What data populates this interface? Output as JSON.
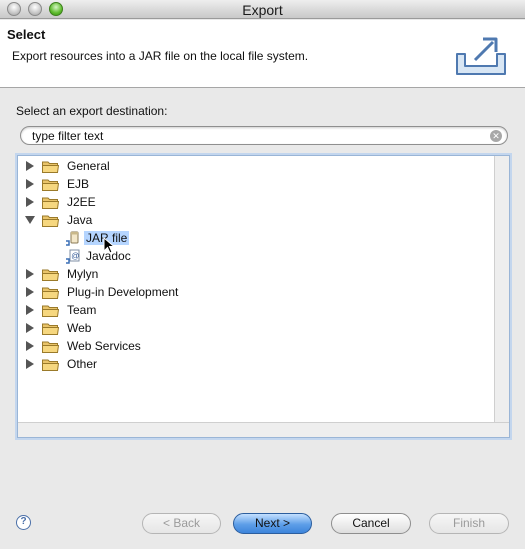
{
  "window": {
    "title": "Export"
  },
  "banner": {
    "title": "Select",
    "description": "Export resources into a JAR file on the local file system."
  },
  "destination": {
    "label": "Select an export destination:",
    "filter_value": "type filter text"
  },
  "tree": {
    "folders": [
      {
        "label": "General",
        "expanded": false
      },
      {
        "label": "EJB",
        "expanded": false
      },
      {
        "label": "J2EE",
        "expanded": false
      },
      {
        "label": "Java",
        "expanded": true
      },
      {
        "label": "Mylyn",
        "expanded": false
      },
      {
        "label": "Plug-in Development",
        "expanded": false
      },
      {
        "label": "Team",
        "expanded": false
      },
      {
        "label": "Web",
        "expanded": false
      },
      {
        "label": "Web Services",
        "expanded": false
      },
      {
        "label": "Other",
        "expanded": false
      }
    ],
    "java_children": [
      {
        "label": "JAR file",
        "icon": "jar-file-icon",
        "selected": true
      },
      {
        "label": "Javadoc",
        "icon": "javadoc-icon",
        "selected": false
      }
    ]
  },
  "buttons": {
    "help": "?",
    "back": "< Back",
    "next": "Next >",
    "cancel": "Cancel",
    "finish": "Finish"
  },
  "colors": {
    "selection": "#b5d5ff",
    "focus_ring": "#c3d6ee",
    "primary_button": "#5d9ee8"
  }
}
